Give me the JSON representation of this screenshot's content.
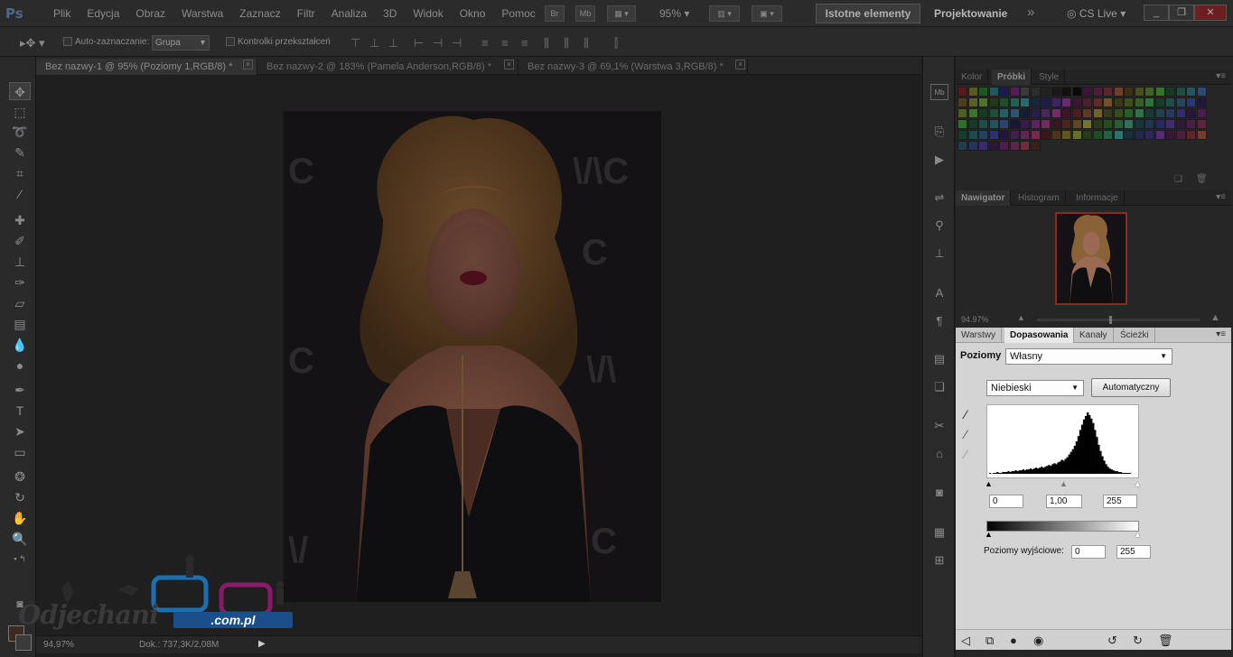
{
  "app": {
    "logo": "Ps",
    "menu": [
      "Plik",
      "Edycja",
      "Obraz",
      "Warstwa",
      "Zaznacz",
      "Filtr",
      "Analiza",
      "3D",
      "Widok",
      "Okno",
      "Pomoc"
    ],
    "bridge_btn": "Br",
    "minibridge_btn": "Mb",
    "zoom": "95%",
    "workspace_active": "Istotne elementy",
    "workspace_other": "Projektowanie",
    "workspace_more": "»",
    "cslive": "CS Live"
  },
  "options": {
    "auto_select_label": "Auto-zaznaczanie:",
    "auto_select_value": "Grupa",
    "transform_label": "Kontrolki przekształceń"
  },
  "tabs": [
    {
      "label": "Bez nazwy-1 @ 95% (Poziomy 1,RGB/8) *"
    },
    {
      "label": "Bez nazwy-2 @ 183% (Pamela Anderson,RGB/8) *"
    },
    {
      "label": "Bez nazwy-3 @ 69,1% (Warstwa 3,RGB/8) *"
    }
  ],
  "status": {
    "zoom": "94,97%",
    "doc": "Dok.: 737,3K/2,08M"
  },
  "watermark": {
    "text": "Odjechani",
    "domain": ".com.pl"
  },
  "panels": {
    "color_tabs": [
      "Kolor",
      "Próbki",
      "Style"
    ],
    "nav_tabs": [
      "Nawigator",
      "Histogram",
      "Informacje"
    ],
    "nav_zoom": "94.97%",
    "adj_tabs": [
      "Warstwy",
      "Dopasowania",
      "Kanały",
      "Ścieżki"
    ]
  },
  "levels": {
    "title": "Poziomy",
    "preset": "Własny",
    "channel": "Niebieski",
    "auto_button": "Automatyczny",
    "input_black": "0",
    "input_gamma": "1,00",
    "input_white": "255",
    "output_label": "Poziomy wyjściowe:",
    "output_black": "0",
    "output_white": "255",
    "histogram": [
      1,
      0,
      1,
      1,
      2,
      1,
      1,
      2,
      2,
      2,
      3,
      2,
      3,
      3,
      4,
      3,
      4,
      4,
      5,
      4,
      5,
      5,
      6,
      5,
      6,
      7,
      6,
      7,
      8,
      7,
      8,
      9,
      10,
      9,
      11,
      12,
      11,
      13,
      14,
      16,
      15,
      17,
      19,
      22,
      25,
      28,
      32,
      37,
      43,
      50,
      56,
      62,
      66,
      70,
      67,
      63,
      58,
      50,
      42,
      33,
      26,
      20,
      15,
      11,
      8,
      6,
      5,
      4,
      3,
      3,
      2,
      2,
      1,
      1,
      1,
      1,
      1,
      0,
      0,
      0
    ]
  },
  "colors": {
    "accent": "#1a4f8c",
    "nav_frame": "#8b2a25"
  }
}
